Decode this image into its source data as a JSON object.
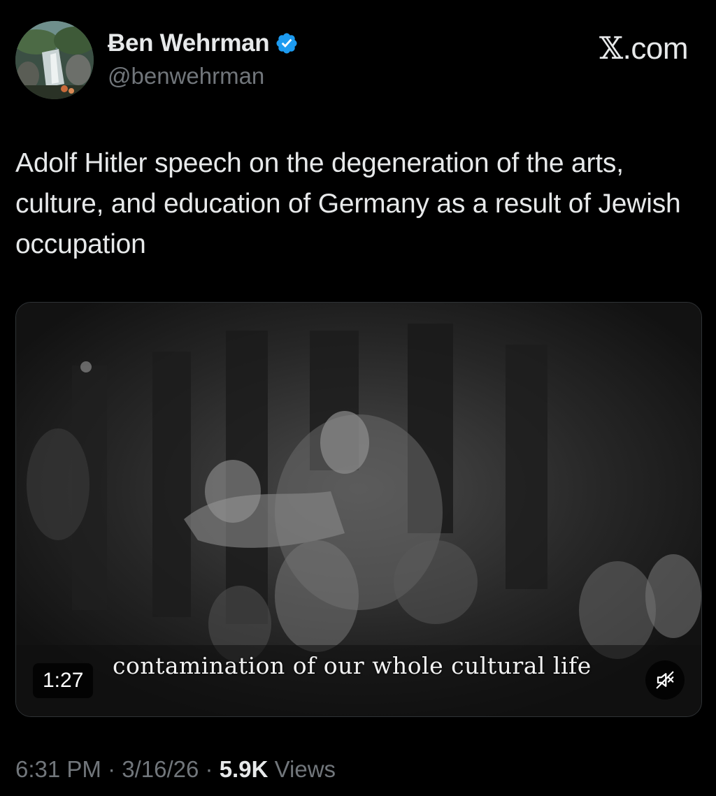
{
  "author": {
    "display_name": "Ƀen Wehrman",
    "handle": "@benwehrman",
    "verified": true,
    "verified_color": "#1d9bf0"
  },
  "brand": {
    "label_x": "𝕏",
    "label_suffix": ".com"
  },
  "tweet": {
    "text": "Adolf Hitler speech on the degeneration of the arts, culture, and education of Germany as a result of Jewish occupation"
  },
  "media": {
    "caption": "contamination of our whole cultural life",
    "duration": "1:27",
    "mute_icon": "speaker-muted-icon"
  },
  "meta": {
    "time": "6:31 PM",
    "separator": "·",
    "date": "3/16/26",
    "views_count": "5.9K",
    "views_label": "Views"
  },
  "colors": {
    "background": "#000000",
    "text_primary": "#e7e9ea",
    "text_secondary": "#71767b"
  }
}
